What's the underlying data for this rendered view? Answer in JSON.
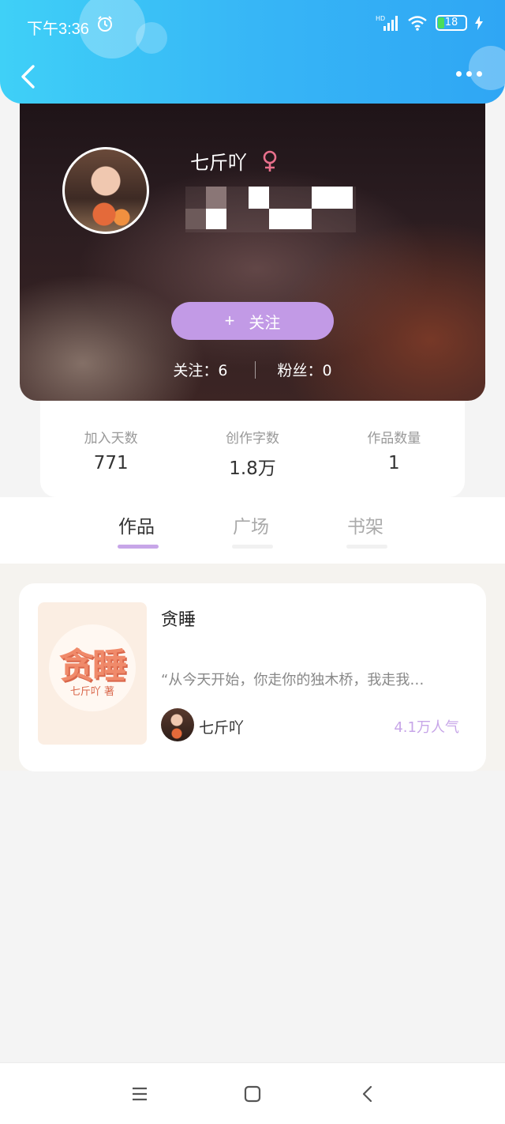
{
  "status_bar": {
    "time": "下午3:36",
    "network": "HD",
    "battery": "18"
  },
  "header": {
    "back_icon": "chevron-left-icon",
    "more_icon": "more-dots-icon"
  },
  "profile": {
    "nickname": "七斤吖",
    "gender_icon": "female-icon",
    "follow_button": "关注",
    "following": "关注：6",
    "followers": "粉丝：0"
  },
  "stats": [
    {
      "label": "加入天数",
      "value": "771"
    },
    {
      "label": "创作字数",
      "value": "1.8万"
    },
    {
      "label": "作品数量",
      "value": "1"
    }
  ],
  "tabs": [
    {
      "label": "作品",
      "active": true
    },
    {
      "label": "广场",
      "active": false
    },
    {
      "label": "书架",
      "active": false
    }
  ],
  "works": [
    {
      "cover_title": "贪睡",
      "cover_author": "七斤吖 著",
      "title": "贪睡",
      "excerpt": "“从今天开始，你走你的独木桥，我走我…",
      "author": "七斤吖",
      "popularity": "4.1万人气"
    }
  ],
  "colors": {
    "header_blue": "#37b6f6",
    "accent_purple": "#c29ae6",
    "popularity_purple": "#c7a6e8"
  }
}
